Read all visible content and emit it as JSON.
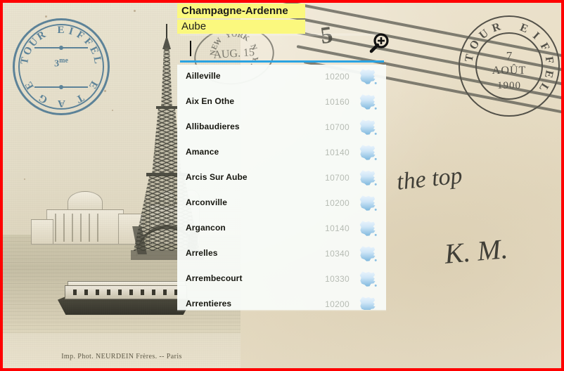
{
  "app": {
    "region_label": "Champagne-Ardenne",
    "department_label": "Aube"
  },
  "search": {
    "value": "",
    "placeholder": "",
    "zoom_icon": "magnifier-plus-icon"
  },
  "background": {
    "type": "vintage-postcard",
    "photo_caption": "Imp. Phot. NEURDEIN Frères. -- Paris",
    "stamp_left": {
      "ring_text": "TOUR EIFFEL",
      "line1": "3",
      "line2": "me",
      "bottom_text": "ETAGE"
    },
    "stamp_right": {
      "ring_text": "TOUR EIFFEL",
      "day": "7",
      "month": "AOÛT",
      "year": "1900"
    },
    "postmark_center": {
      "ring_text": "NEW YORK N.Y.",
      "date": "AUG. 15"
    },
    "cancel_numeral": "5",
    "handwriting_1": "the top",
    "handwriting_2": "K. M."
  },
  "colors": {
    "border": "#ff0000",
    "highlight": "#fbf87e",
    "underline": "#2aa3e2",
    "panel": "#f8fbf8",
    "code_text": "#b7bcb4",
    "name_text": "#16160f",
    "stamp_blue": "#3f6f8e"
  },
  "list": {
    "items": [
      {
        "name": "Ailleville",
        "code": "10200",
        "icon": "france-map-icon"
      },
      {
        "name": "Aix En Othe",
        "code": "10160",
        "icon": "france-map-icon"
      },
      {
        "name": "Allibaudieres",
        "code": "10700",
        "icon": "france-map-icon"
      },
      {
        "name": "Amance",
        "code": "10140",
        "icon": "france-map-icon"
      },
      {
        "name": "Arcis Sur Aube",
        "code": "10700",
        "icon": "france-map-icon"
      },
      {
        "name": "Arconville",
        "code": "10200",
        "icon": "france-map-icon"
      },
      {
        "name": "Argancon",
        "code": "10140",
        "icon": "france-map-icon"
      },
      {
        "name": "Arrelles",
        "code": "10340",
        "icon": "france-map-icon"
      },
      {
        "name": "Arrembecourt",
        "code": "10330",
        "icon": "france-map-icon"
      },
      {
        "name": "Arrentieres",
        "code": "10200",
        "icon": "france-map-icon"
      }
    ]
  }
}
